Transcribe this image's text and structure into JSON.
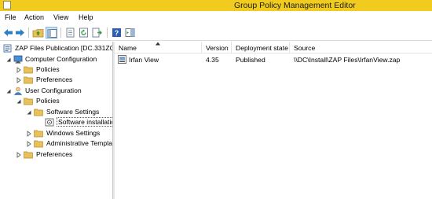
{
  "window": {
    "title": "Group Policy Management Editor"
  },
  "menu": {
    "items": [
      "File",
      "Action",
      "View",
      "Help"
    ]
  },
  "toolbar": {
    "buttons": [
      "back-icon",
      "forward-icon",
      "up-folder-icon",
      "show-hide-tree-icon",
      "properties-icon",
      "refresh-icon",
      "export-list-icon",
      "help-icon",
      "action-pane-icon"
    ]
  },
  "tree": {
    "nodes": [
      {
        "label": "ZAP Files Publication [DC.331ZQ",
        "icon": "gpo-icon"
      },
      {
        "label": "Computer Configuration",
        "icon": "computer-icon"
      },
      {
        "label": "Policies",
        "icon": "folder-icon"
      },
      {
        "label": "Preferences",
        "icon": "folder-icon"
      },
      {
        "label": "User Configuration",
        "icon": "user-icon"
      },
      {
        "label": "Policies",
        "icon": "folder-icon"
      },
      {
        "label": "Software Settings",
        "icon": "folder-icon"
      },
      {
        "label": "Software installation",
        "icon": "software-install-icon"
      },
      {
        "label": "Windows Settings",
        "icon": "folder-icon"
      },
      {
        "label": "Administrative Templates",
        "icon": "folder-icon"
      },
      {
        "label": "Preferences",
        "icon": "folder-icon"
      }
    ]
  },
  "list": {
    "columns": [
      "Name",
      "Version",
      "Deployment state",
      "Source"
    ],
    "rows": [
      {
        "name": "Irfan View",
        "version": "4.35",
        "state": "Published",
        "source": "\\\\DC\\Install\\ZAP Files\\IrfanView.zap"
      }
    ]
  },
  "colors": {
    "titlebar": "#f1cc1e",
    "folder": "#e8c15a",
    "selection": "#cce4f7",
    "nav-arrows": "#2e7ec7"
  }
}
